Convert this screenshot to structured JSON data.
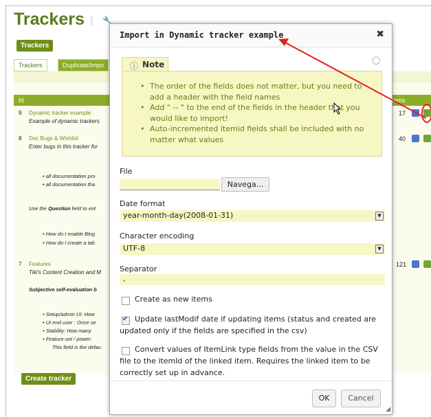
{
  "page": {
    "title": "Trackers",
    "trackers_button": "Trackers",
    "tabs": [
      "Trackers",
      "Duplicate/Impo"
    ],
    "table_header": {
      "id": "Id",
      "items": "tems"
    },
    "rows": [
      {
        "num": "9",
        "name": "Dynamic tracker example",
        "desc": "Example of dynamic trackers",
        "items": "17"
      },
      {
        "num": "8",
        "name": "Doc Bugs & Wishlist",
        "desc": "Enter bugs in this tracker for",
        "items": "40"
      },
      {
        "num": "7",
        "name": "Features",
        "desc": "Tiki's Content Creation and M",
        "items": "121"
      }
    ],
    "row8_bullets": [
      "all documentation pro",
      "all documentation tha"
    ],
    "row8_question": [
      "Use the ",
      "Question",
      " field to ent"
    ],
    "row8_bullets2": [
      "How do I enable Blog",
      "How do I create a tab"
    ],
    "row7_subjective": "Subjective self-evaluation b",
    "row7_bullets": [
      "Setup/admin UI: How",
      "UI end user : Once se",
      "Stability: How many",
      "Feature-set / power:"
    ],
    "row7_default": "This field is the defau",
    "create_button": "Create tracker"
  },
  "modal": {
    "title": "Import in Dynamic tracker example",
    "close_symbol": "✖",
    "note_title": "Note",
    "note_items": [
      "The order of the fields does not matter, but you need to add a header with the field names",
      "Add \" -- \" to the end of the fields in the header that you would like to import!",
      "Auto-incremented itemid fields shall be included with no matter what values"
    ],
    "file_label": "File",
    "browse_label": "Navega...",
    "date_format_label": "Date format",
    "date_format_value": "year-month-day(2008-01-31)",
    "encoding_label": "Character encoding",
    "encoding_value": "UTF-8",
    "separator_label": "Separator",
    "separator_value": ",",
    "create_new_label": "Create as new items",
    "update_label": "Update lastModif date if updating items (status and created are updated only if the fields are specified in the csv)",
    "convert_label": "Convert values of ItemLink type fields from the value in the CSV file to the itemId of the linked item. Requires the linked item to be correctly set up in advance.",
    "ok_label": "OK",
    "cancel_label": "Cancel"
  },
  "colors": {
    "brand_green": "#6f8e16",
    "note_bg": "#f7f7c3",
    "arrow": "#e52020"
  }
}
